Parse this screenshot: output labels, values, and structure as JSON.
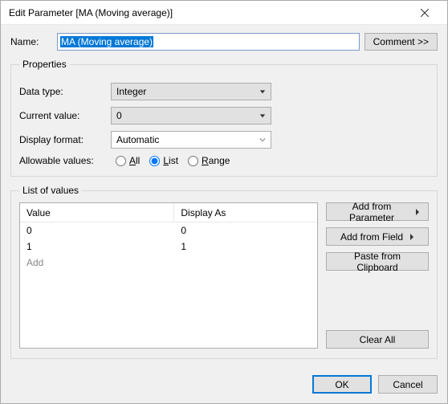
{
  "window": {
    "title": "Edit Parameter [MA (Moving average)]"
  },
  "nameRow": {
    "label": "Name:",
    "value": "MA (Moving average)",
    "commentBtn": "Comment >>"
  },
  "properties": {
    "legend": "Properties",
    "dataTypeLabel": "Data type:",
    "dataTypeValue": "Integer",
    "currentValueLabel": "Current value:",
    "currentValueValue": "0",
    "displayFormatLabel": "Display format:",
    "displayFormatValue": "Automatic",
    "allowableLabel": "Allowable values:",
    "radioAll": "All",
    "radioList": "List",
    "radioRange": "Range",
    "selected": "List"
  },
  "listOfValues": {
    "legend": "List of values",
    "colValue": "Value",
    "colDisplay": "Display As",
    "rows": [
      {
        "value": "0",
        "display": "0"
      },
      {
        "value": "1",
        "display": "1"
      }
    ],
    "addPlaceholder": "Add",
    "btnAddParam": "Add from Parameter",
    "btnAddField": "Add from Field",
    "btnPaste": "Paste from Clipboard",
    "btnClear": "Clear All"
  },
  "footer": {
    "ok": "OK",
    "cancel": "Cancel"
  }
}
